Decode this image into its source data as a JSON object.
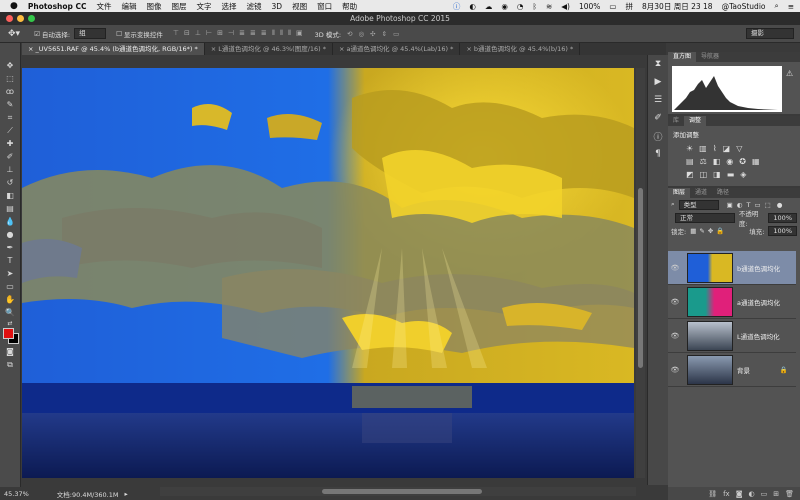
{
  "menubar": {
    "apple": "",
    "app_name": "Photoshop CC",
    "items": [
      "文件",
      "编辑",
      "图像",
      "图层",
      "文字",
      "选择",
      "滤镜",
      "3D",
      "视图",
      "窗口",
      "帮助"
    ],
    "battery": "100%",
    "datetime": "8月30日 周日  23 18",
    "user": "@TaoStudio"
  },
  "window": {
    "title": "Adobe Photoshop CC 2015"
  },
  "options_bar": {
    "auto_select_label": "自动选择:",
    "auto_select_value": "组",
    "show_transform_label": "显示变换控件",
    "mode_3d_label": "3D 模式:",
    "workspace": "摄影"
  },
  "tabs": [
    {
      "label": "_UV5651.RAF @ 45.4% (b通道色调均化, RGB/16*) *",
      "active": true
    },
    {
      "label": "L通道色调均化 @ 46.3%(图度/16) *",
      "active": false
    },
    {
      "label": "a通道色调均化 @ 45.4%(Lab/16) *",
      "active": false
    },
    {
      "label": "b通道色调均化 @ 45.4%(b/16) *",
      "active": false
    }
  ],
  "status": {
    "zoom": "45.37%",
    "doc_size": "文档:90.4M/360.1M"
  },
  "histogram_panel": {
    "tabs": [
      "直方图",
      "导航器"
    ]
  },
  "adjust_panel": {
    "tabs": [
      "库",
      "调整"
    ],
    "title": "添加调整"
  },
  "layers_panel": {
    "tabs": [
      "图层",
      "通道",
      "路径"
    ],
    "filter": "类型",
    "blend_mode": "正常",
    "opacity_label": "不透明度:",
    "opacity_value": "100%",
    "lock_label": "锁定:",
    "fill_label": "填充:",
    "fill_value": "100%",
    "layers": [
      {
        "name": "b通道色调均化",
        "selected": true
      },
      {
        "name": "a通道色调均化",
        "selected": false
      },
      {
        "name": "L通道色调均化",
        "selected": false
      },
      {
        "name": "背景",
        "selected": false
      }
    ]
  },
  "colors": {
    "foreground": "#e01010",
    "background": "#000000",
    "selected_layer": "#7d8ca8"
  }
}
